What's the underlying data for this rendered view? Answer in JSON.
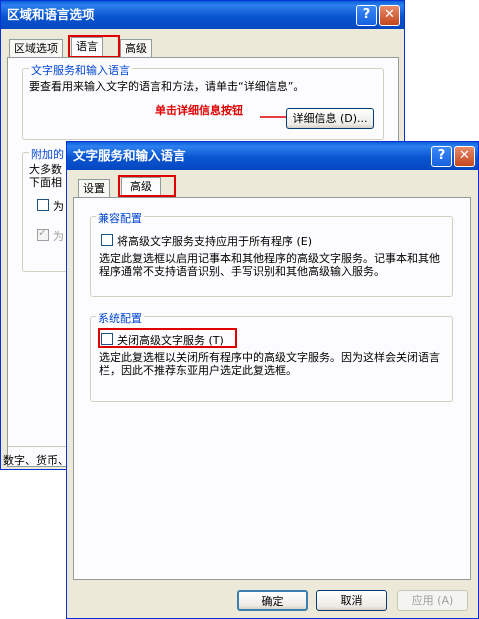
{
  "back_window": {
    "title": "区域和语言选项",
    "help_btn": "?",
    "close_btn": "✕",
    "tabs": [
      "区域选项",
      "语言",
      "高级"
    ],
    "group_title": "文字服务和输入语言",
    "group_desc": "要查看用来输入文字的语言和方法，请单击“详细信息”。",
    "annotation": "单击详细信息按钮",
    "details_button": "详细信息 (D)...",
    "supplemental_title": "附加的",
    "supplemental_text_1": "大多数",
    "supplemental_text_2": "下面相",
    "check1_label": "为",
    "check2_label": "为",
    "bottom_text": "数字、货币、"
  },
  "front_window": {
    "title": "文字服务和输入语言",
    "help_btn": "?",
    "close_btn": "✕",
    "tabs": [
      "设置",
      "高级"
    ],
    "compat": {
      "title": "兼容配置",
      "checkbox_label": "将高级文字服务支持应用于所有程序 (E)",
      "desc": "选定此复选框以启用记事本和其他程序的高级文字服务。记事本和其他程序通常不支持语音识别、手写识别和其他高级输入服务。"
    },
    "system": {
      "title": "系统配置",
      "checkbox_label": "关闭高级文字服务 (T)",
      "desc": "选定此复选框以关闭所有程序中的高级文字服务。因为这样会关闭语言栏，因此不推荐东亚用户选定此复选框。"
    },
    "ok_button": "确定",
    "cancel_button": "取消",
    "apply_button": "应用 (A)"
  },
  "colors": {
    "annotation_red": "#e00000",
    "group_title_blue": "#0046d5"
  }
}
